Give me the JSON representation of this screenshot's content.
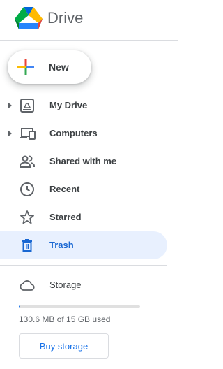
{
  "app": {
    "title": "Drive"
  },
  "new_button": {
    "label": "New"
  },
  "nav": [
    {
      "label": "My Drive",
      "icon": "my-drive-icon"
    },
    {
      "label": "Computers",
      "icon": "computers-icon"
    },
    {
      "label": "Shared with me",
      "icon": "shared-with-me-icon"
    },
    {
      "label": "Recent",
      "icon": "recent-clock-icon"
    },
    {
      "label": "Starred",
      "icon": "star-icon"
    },
    {
      "label": "Trash",
      "icon": "trash-icon",
      "active": true
    }
  ],
  "storage": {
    "label": "Storage",
    "usage_text": "130.6 MB of 15 GB used",
    "used_fraction": 0.0087,
    "buy_label": "Buy storage"
  },
  "colors": {
    "accent": "#1a73e8",
    "active_bg": "#e8f0fe",
    "active_text": "#1967d2",
    "text": "#3c4043"
  }
}
